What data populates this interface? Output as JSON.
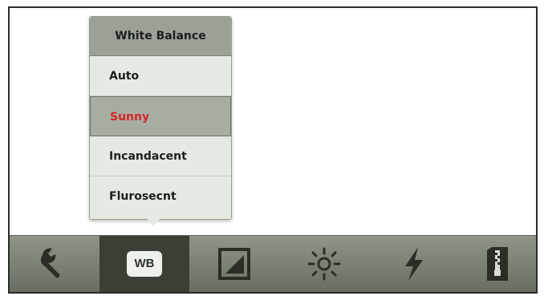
{
  "popup": {
    "title": "White Balance",
    "items": [
      {
        "label": "Auto",
        "selected": false
      },
      {
        "label": "Sunny",
        "selected": true
      },
      {
        "label": "Incandacent",
        "selected": false
      },
      {
        "label": "Flurosecnt",
        "selected": false
      }
    ],
    "selected_color": "#d42424"
  },
  "toolbar": {
    "wb_label": "WB",
    "buttons": [
      {
        "icon": "wrench-icon"
      },
      {
        "icon": "wb-icon",
        "active": true
      },
      {
        "icon": "exposure-icon"
      },
      {
        "icon": "brightness-icon"
      },
      {
        "icon": "flash-icon"
      },
      {
        "icon": "storage-card-icon"
      }
    ]
  }
}
